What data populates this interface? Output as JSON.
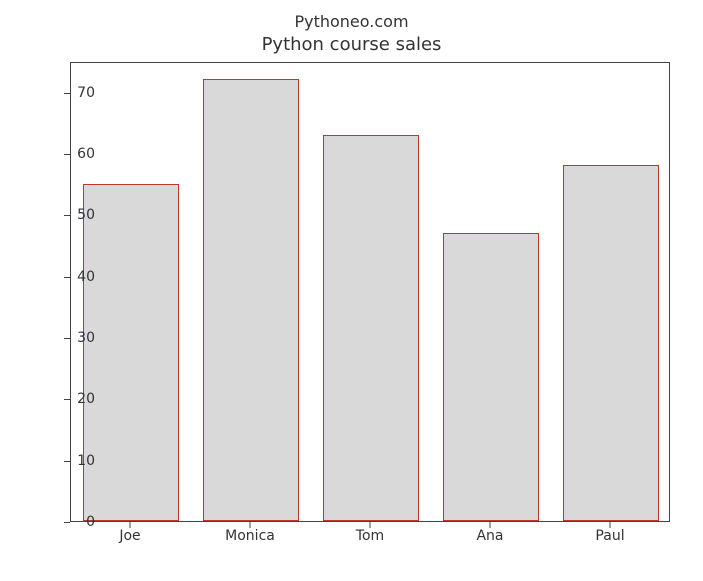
{
  "chart_data": {
    "type": "bar",
    "categories": [
      "Joe",
      "Monica",
      "Tom",
      "Ana",
      "Paul"
    ],
    "values": [
      55,
      72,
      63,
      47,
      58
    ],
    "suptitle": "Pythoneo.com",
    "title": "Python course sales",
    "xlabel": "",
    "ylabel": "",
    "ylim": [
      0,
      75
    ],
    "yticks": [
      0,
      10,
      20,
      30,
      40,
      50,
      60,
      70
    ],
    "bar_fill": "#d9d9d9",
    "bar_edge": "#c1352a"
  }
}
